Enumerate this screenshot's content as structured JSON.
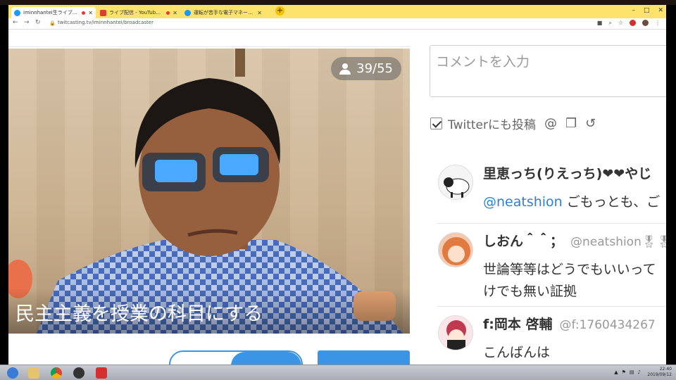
{
  "browser": {
    "tabs": [
      {
        "title": "iminnhantei生ライブ配信",
        "active": true,
        "color": "#2196f3"
      },
      {
        "title": "ライブ配信 - YouTube Studio",
        "active": false,
        "color": "#e53935"
      },
      {
        "title": "運転が苦手な電子マネーの活用が…",
        "active": false,
        "color": "#2196f3"
      }
    ],
    "new_tab": "+",
    "window_controls": [
      "–",
      "□",
      "✕"
    ],
    "url": "twitcasting.tv/iminnhantei/broadcaster"
  },
  "video": {
    "viewer_count": "39/55",
    "subtitle": "民主主義を授業の科目にする"
  },
  "comment_box": {
    "placeholder": "コメントを入力",
    "twitter_label": "Twitterにも投稿"
  },
  "comments": [
    {
      "name": "里恵っち(りえっち)❤❤やじ",
      "handle": "",
      "mention": "@neatshion",
      "text": " ごもっとも、ご",
      "text2": ""
    },
    {
      "name": "しおん＾＾；",
      "handle": "@neatshion🎖🎖",
      "mention": "",
      "text": "世論等等はどうでもいいって",
      "text2": "けでも無い証拠"
    },
    {
      "name": "f:岡本 啓輔",
      "handle": "@f:1760434267",
      "mention": "",
      "text": "こんばんは",
      "text2": ""
    }
  ],
  "taskbar": {
    "time": "22:40",
    "date": "2019/09/12"
  }
}
